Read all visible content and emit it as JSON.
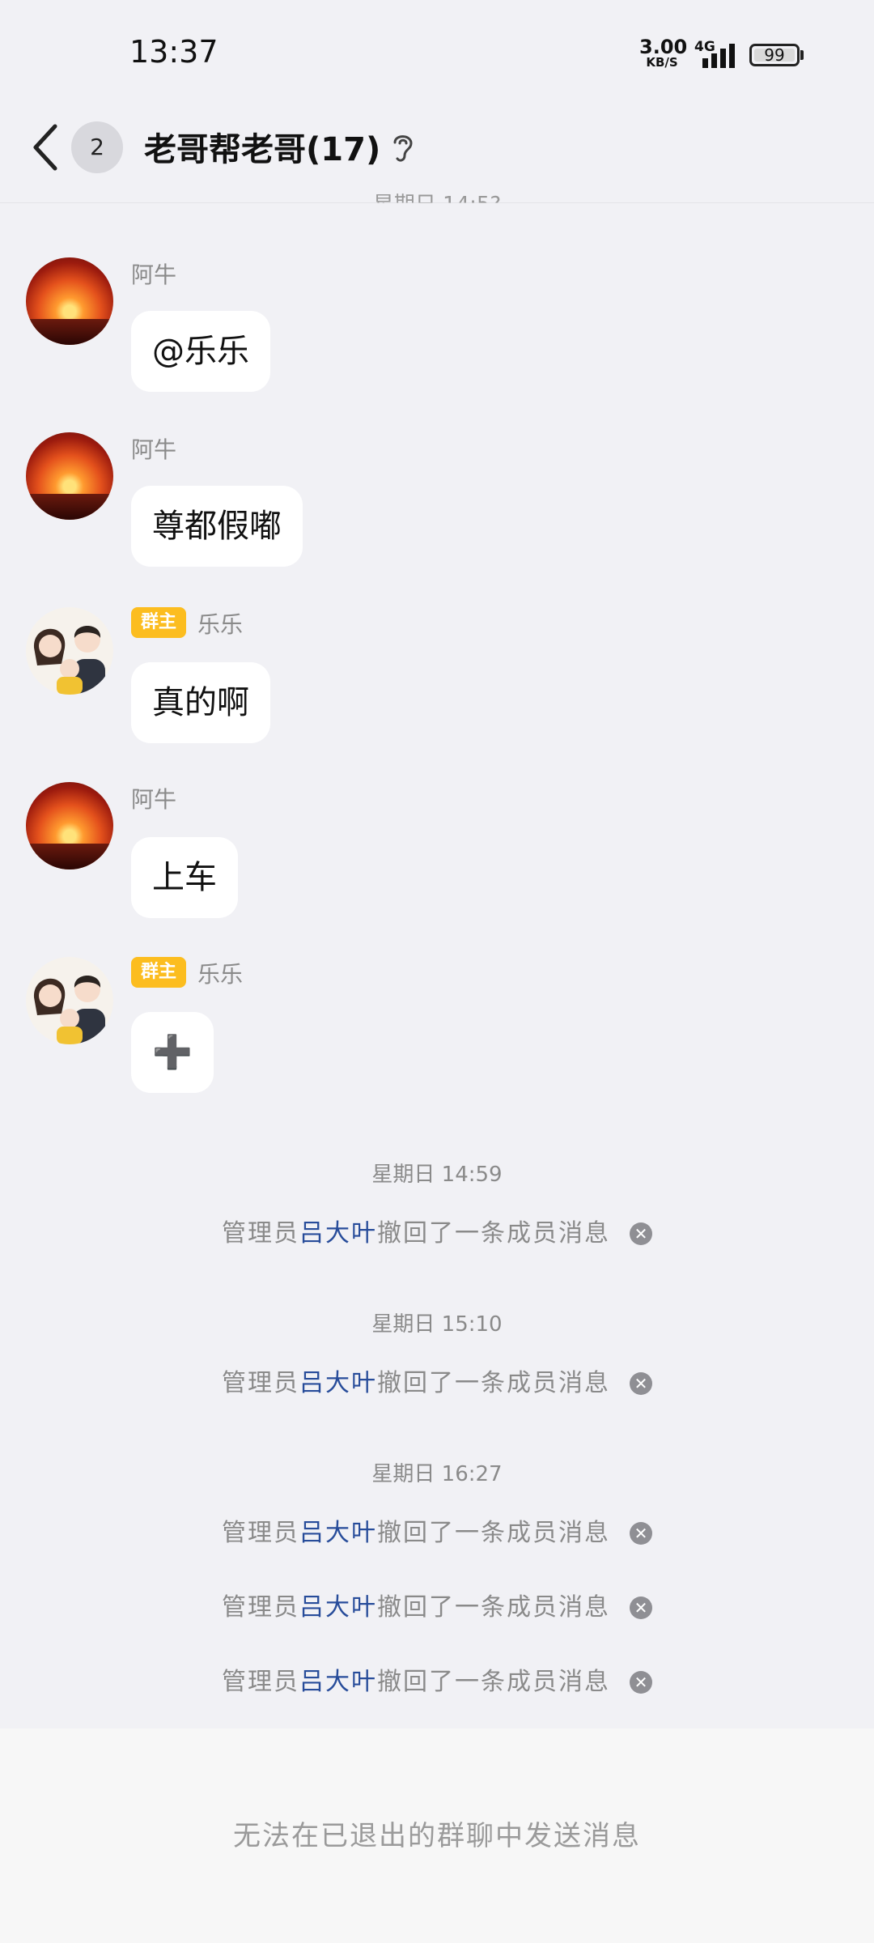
{
  "status_bar": {
    "time": "13:37",
    "net_speed_value": "3.00",
    "net_speed_unit": "KB/S",
    "net_type": "4G",
    "battery": "99"
  },
  "header": {
    "unread_count": "2",
    "title": "老哥帮老哥(17)"
  },
  "messages": [
    {
      "sender": "阿牛",
      "text": "@乐乐"
    },
    {
      "sender": "阿牛",
      "text": "尊都假嘟"
    },
    {
      "sender": "乐乐",
      "badge": "群主",
      "text": "真的啊"
    },
    {
      "sender": "阿牛",
      "text": "上车"
    },
    {
      "sender": "乐乐",
      "badge": "群主",
      "text": "➕"
    }
  ],
  "system": {
    "prefix": "管理员",
    "admin_name": "吕大叶",
    "suffix": "撤回了一条成员消息",
    "times": [
      "星期日 14:59",
      "星期日 15:10",
      "星期日 16:27"
    ]
  },
  "footer": {
    "notice": "无法在已退出的群聊中发送消息"
  }
}
